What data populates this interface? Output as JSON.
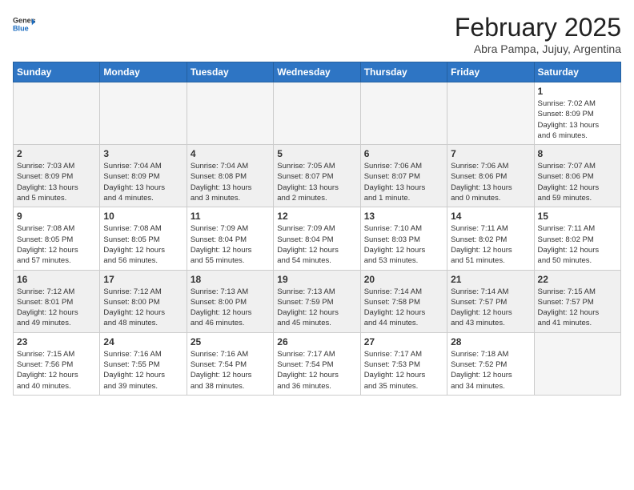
{
  "header": {
    "logo_general": "General",
    "logo_blue": "Blue",
    "title": "February 2025",
    "subtitle": "Abra Pampa, Jujuy, Argentina"
  },
  "weekdays": [
    "Sunday",
    "Monday",
    "Tuesday",
    "Wednesday",
    "Thursday",
    "Friday",
    "Saturday"
  ],
  "weeks": [
    [
      {
        "day": "",
        "info": ""
      },
      {
        "day": "",
        "info": ""
      },
      {
        "day": "",
        "info": ""
      },
      {
        "day": "",
        "info": ""
      },
      {
        "day": "",
        "info": ""
      },
      {
        "day": "",
        "info": ""
      },
      {
        "day": "1",
        "info": "Sunrise: 7:02 AM\nSunset: 8:09 PM\nDaylight: 13 hours\nand 6 minutes."
      }
    ],
    [
      {
        "day": "2",
        "info": "Sunrise: 7:03 AM\nSunset: 8:09 PM\nDaylight: 13 hours\nand 5 minutes."
      },
      {
        "day": "3",
        "info": "Sunrise: 7:04 AM\nSunset: 8:09 PM\nDaylight: 13 hours\nand 4 minutes."
      },
      {
        "day": "4",
        "info": "Sunrise: 7:04 AM\nSunset: 8:08 PM\nDaylight: 13 hours\nand 3 minutes."
      },
      {
        "day": "5",
        "info": "Sunrise: 7:05 AM\nSunset: 8:07 PM\nDaylight: 13 hours\nand 2 minutes."
      },
      {
        "day": "6",
        "info": "Sunrise: 7:06 AM\nSunset: 8:07 PM\nDaylight: 13 hours\nand 1 minute."
      },
      {
        "day": "7",
        "info": "Sunrise: 7:06 AM\nSunset: 8:06 PM\nDaylight: 13 hours\nand 0 minutes."
      },
      {
        "day": "8",
        "info": "Sunrise: 7:07 AM\nSunset: 8:06 PM\nDaylight: 12 hours\nand 59 minutes."
      }
    ],
    [
      {
        "day": "9",
        "info": "Sunrise: 7:08 AM\nSunset: 8:05 PM\nDaylight: 12 hours\nand 57 minutes."
      },
      {
        "day": "10",
        "info": "Sunrise: 7:08 AM\nSunset: 8:05 PM\nDaylight: 12 hours\nand 56 minutes."
      },
      {
        "day": "11",
        "info": "Sunrise: 7:09 AM\nSunset: 8:04 PM\nDaylight: 12 hours\nand 55 minutes."
      },
      {
        "day": "12",
        "info": "Sunrise: 7:09 AM\nSunset: 8:04 PM\nDaylight: 12 hours\nand 54 minutes."
      },
      {
        "day": "13",
        "info": "Sunrise: 7:10 AM\nSunset: 8:03 PM\nDaylight: 12 hours\nand 53 minutes."
      },
      {
        "day": "14",
        "info": "Sunrise: 7:11 AM\nSunset: 8:02 PM\nDaylight: 12 hours\nand 51 minutes."
      },
      {
        "day": "15",
        "info": "Sunrise: 7:11 AM\nSunset: 8:02 PM\nDaylight: 12 hours\nand 50 minutes."
      }
    ],
    [
      {
        "day": "16",
        "info": "Sunrise: 7:12 AM\nSunset: 8:01 PM\nDaylight: 12 hours\nand 49 minutes."
      },
      {
        "day": "17",
        "info": "Sunrise: 7:12 AM\nSunset: 8:00 PM\nDaylight: 12 hours\nand 48 minutes."
      },
      {
        "day": "18",
        "info": "Sunrise: 7:13 AM\nSunset: 8:00 PM\nDaylight: 12 hours\nand 46 minutes."
      },
      {
        "day": "19",
        "info": "Sunrise: 7:13 AM\nSunset: 7:59 PM\nDaylight: 12 hours\nand 45 minutes."
      },
      {
        "day": "20",
        "info": "Sunrise: 7:14 AM\nSunset: 7:58 PM\nDaylight: 12 hours\nand 44 minutes."
      },
      {
        "day": "21",
        "info": "Sunrise: 7:14 AM\nSunset: 7:57 PM\nDaylight: 12 hours\nand 43 minutes."
      },
      {
        "day": "22",
        "info": "Sunrise: 7:15 AM\nSunset: 7:57 PM\nDaylight: 12 hours\nand 41 minutes."
      }
    ],
    [
      {
        "day": "23",
        "info": "Sunrise: 7:15 AM\nSunset: 7:56 PM\nDaylight: 12 hours\nand 40 minutes."
      },
      {
        "day": "24",
        "info": "Sunrise: 7:16 AM\nSunset: 7:55 PM\nDaylight: 12 hours\nand 39 minutes."
      },
      {
        "day": "25",
        "info": "Sunrise: 7:16 AM\nSunset: 7:54 PM\nDaylight: 12 hours\nand 38 minutes."
      },
      {
        "day": "26",
        "info": "Sunrise: 7:17 AM\nSunset: 7:54 PM\nDaylight: 12 hours\nand 36 minutes."
      },
      {
        "day": "27",
        "info": "Sunrise: 7:17 AM\nSunset: 7:53 PM\nDaylight: 12 hours\nand 35 minutes."
      },
      {
        "day": "28",
        "info": "Sunrise: 7:18 AM\nSunset: 7:52 PM\nDaylight: 12 hours\nand 34 minutes."
      },
      {
        "day": "",
        "info": ""
      }
    ]
  ]
}
